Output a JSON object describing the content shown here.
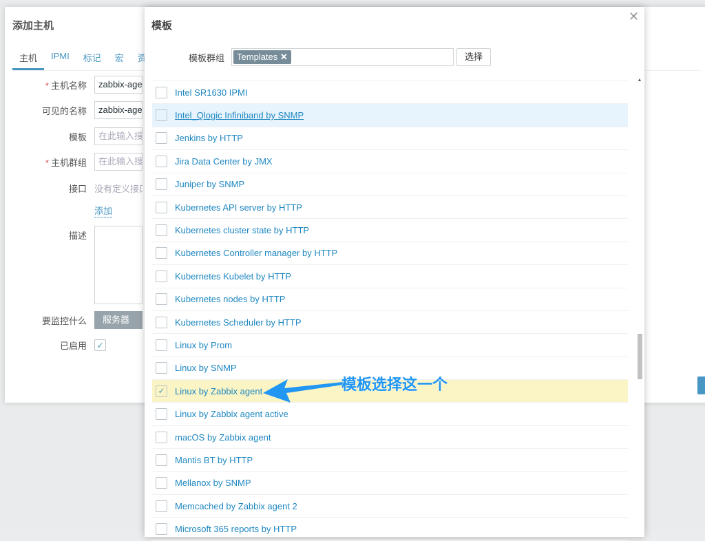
{
  "host_dialog": {
    "title": "添加主机",
    "tabs": [
      "主机",
      "IPMI",
      "标记",
      "宏",
      "资"
    ],
    "fields": {
      "host_name_label": "主机名称",
      "host_name": "zabbix-agent",
      "visible_name_label": "可见的名称",
      "visible_name": "zabbix-agent",
      "templates_label": "模板",
      "templates_placeholder": "在此输入搜索",
      "groups_label": "主机群组",
      "groups_placeholder": "在此输入搜索",
      "interfaces_label": "接口",
      "interfaces_value": "没有定义接口。",
      "add_link": "添加",
      "description_label": "描述",
      "monitor_label": "要监控什么",
      "monitor_button": "服务器",
      "enabled_label": "已启用"
    }
  },
  "modal": {
    "title": "模板",
    "group_label": "模板群组",
    "group_tag": "Templates",
    "select_button": "选择",
    "items": [
      {
        "name": "Intel SR1630 IPMI",
        "checked": false
      },
      {
        "name": "Intel_Qlogic Infiniband by SNMP",
        "checked": false,
        "hover": true
      },
      {
        "name": "Jenkins by HTTP",
        "checked": false
      },
      {
        "name": "Jira Data Center by JMX",
        "checked": false
      },
      {
        "name": "Juniper by SNMP",
        "checked": false
      },
      {
        "name": "Kubernetes API server by HTTP",
        "checked": false
      },
      {
        "name": "Kubernetes cluster state by HTTP",
        "checked": false
      },
      {
        "name": "Kubernetes Controller manager by HTTP",
        "checked": false
      },
      {
        "name": "Kubernetes Kubelet by HTTP",
        "checked": false
      },
      {
        "name": "Kubernetes nodes by HTTP",
        "checked": false
      },
      {
        "name": "Kubernetes Scheduler by HTTP",
        "checked": false
      },
      {
        "name": "Linux by Prom",
        "checked": false
      },
      {
        "name": "Linux by SNMP",
        "checked": false
      },
      {
        "name": "Linux by Zabbix agent",
        "checked": true
      },
      {
        "name": "Linux by Zabbix agent active",
        "checked": false
      },
      {
        "name": "macOS by Zabbix agent",
        "checked": false
      },
      {
        "name": "Mantis BT by HTTP",
        "checked": false
      },
      {
        "name": "Mellanox by SNMP",
        "checked": false
      },
      {
        "name": "Memcached by Zabbix agent 2",
        "checked": false
      },
      {
        "name": "Microsoft 365 reports by HTTP",
        "checked": false
      }
    ]
  },
  "annotation": "模板选择这一个",
  "colors": {
    "accent": "#1e87c1",
    "selected_row": "#fbf5c5",
    "hover_row": "#e8f4fd",
    "annotation": "#2196f3"
  }
}
